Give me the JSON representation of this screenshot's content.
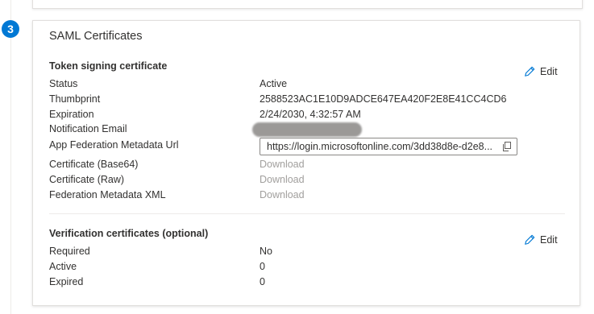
{
  "step": {
    "number": "3"
  },
  "card": {
    "title": "SAML Certificates",
    "token_section": {
      "title": "Token signing certificate",
      "edit_label": "Edit",
      "rows": [
        {
          "label": "Status",
          "value": "Active"
        },
        {
          "label": "Thumbprint",
          "value": "2588523AC1E10D9ADCE647EA420F2E8E41CC4CD6"
        },
        {
          "label": "Expiration",
          "value": "2/24/2030, 4:32:57 AM"
        },
        {
          "label": "Notification Email",
          "value": ""
        },
        {
          "label": "App Federation Metadata Url",
          "value": "https://login.microsoftonline.com/3dd38d8e-d2e8..."
        },
        {
          "label": "Certificate (Base64)",
          "value": "Download"
        },
        {
          "label": "Certificate (Raw)",
          "value": "Download"
        },
        {
          "label": "Federation Metadata XML",
          "value": "Download"
        }
      ]
    },
    "verification_section": {
      "title": "Verification certificates (optional)",
      "edit_label": "Edit",
      "rows": [
        {
          "label": "Required",
          "value": "No"
        },
        {
          "label": "Active",
          "value": "0"
        },
        {
          "label": "Expired",
          "value": "0"
        }
      ]
    }
  },
  "colors": {
    "accent": "#0078d4",
    "text": "#323130",
    "disabled_link": "#a19f9d",
    "border": "#e1dfdd"
  },
  "icons": {
    "edit": "pencil-icon",
    "copy": "copy-icon"
  }
}
